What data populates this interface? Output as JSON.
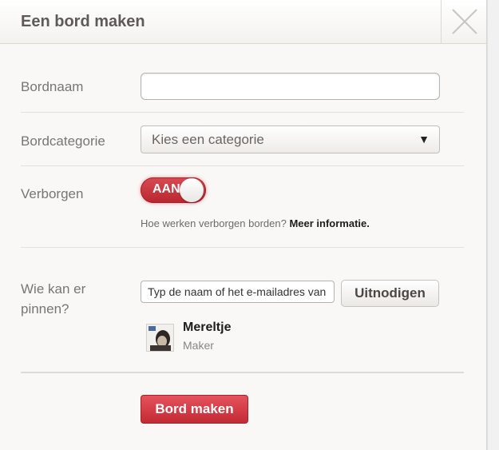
{
  "dialog": {
    "title": "Een bord maken",
    "close_icon": "close-x-icon"
  },
  "form": {
    "board_name": {
      "label": "Bordnaam",
      "value": ""
    },
    "board_category": {
      "label": "Bordcategorie",
      "selected": "Kies een categorie",
      "arrow": "▼"
    },
    "hidden": {
      "label": "Verborgen",
      "toggle_text": "AAN",
      "toggle_on": true,
      "hint_text": "Hoe werken verborgen borden?",
      "hint_link": "Meer informatie."
    },
    "pinners": {
      "label_line1": "Wie kan er",
      "label_line2": "pinnen?",
      "input_value": "Typ de naam of het e-mailadres van",
      "invite_button": "Uitnodigen",
      "member": {
        "name": "Mereltje",
        "role": "Maker"
      }
    },
    "submit_button": "Bord maken"
  },
  "colors": {
    "accent": "#cb2d3a",
    "title_text": "#5f5a58",
    "label_text": "#7a7572"
  }
}
